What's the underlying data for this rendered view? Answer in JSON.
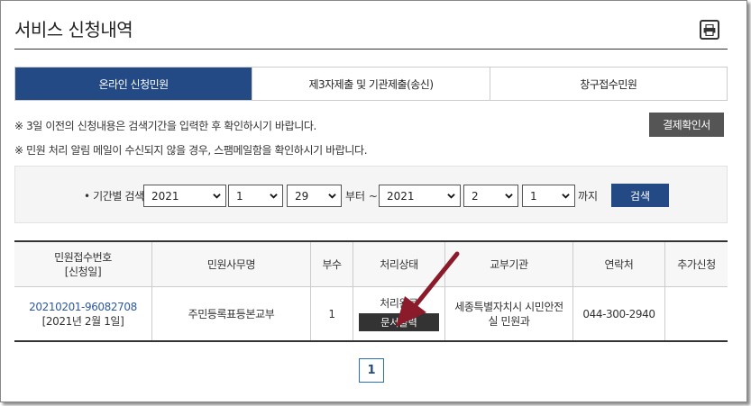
{
  "page": {
    "title": "서비스 신청내역"
  },
  "tabs": [
    {
      "label": "온라인 신청민원",
      "active": true
    },
    {
      "label": "제3자제출 및 기관제출(송신)",
      "active": false
    },
    {
      "label": "창구접수민원",
      "active": false
    }
  ],
  "notices": [
    "※ 3일 이전의 신청내용은 검색기간을 입력한 후 확인하시기 바랍니다.",
    "※ 민원 처리 알림 메일이 수신되지 않을 경우, 스팸메일함을 확인하시기 바랍니다."
  ],
  "payment_button": "결제확인서",
  "search": {
    "label": "• 기간별 검색",
    "from_year": "2021",
    "from_month": "1",
    "from_day": "29",
    "from_suffix": "부터 ~",
    "to_year": "2021",
    "to_month": "2",
    "to_day": "1",
    "to_suffix": "까지",
    "button": "검색"
  },
  "table": {
    "headers": {
      "receipt_no": "민원접수번호",
      "apply_date": "[신청일]",
      "service_name": "민원사무명",
      "copies": "부수",
      "status": "처리상태",
      "agency": "교부기관",
      "contact": "연락처",
      "extra": "추가신청"
    },
    "rows": [
      {
        "receipt_no": "20210201-96082708",
        "apply_date": "[2021년 2월 1일]",
        "service_name": "주민등록표등본교부",
        "copies": "1",
        "status": "처리완료",
        "print_button": "문서출력",
        "agency": "세종특별자치시 시민안전실 민원과",
        "contact": "044-300-2940",
        "extra": ""
      }
    ]
  },
  "pagination": {
    "current": "1"
  },
  "colors": {
    "primary": "#244a86",
    "annotation": "#8b1a2b",
    "dark_button": "#333333"
  },
  "icons": {
    "print": "printer-icon",
    "dropdown": "chevron-down-icon"
  }
}
